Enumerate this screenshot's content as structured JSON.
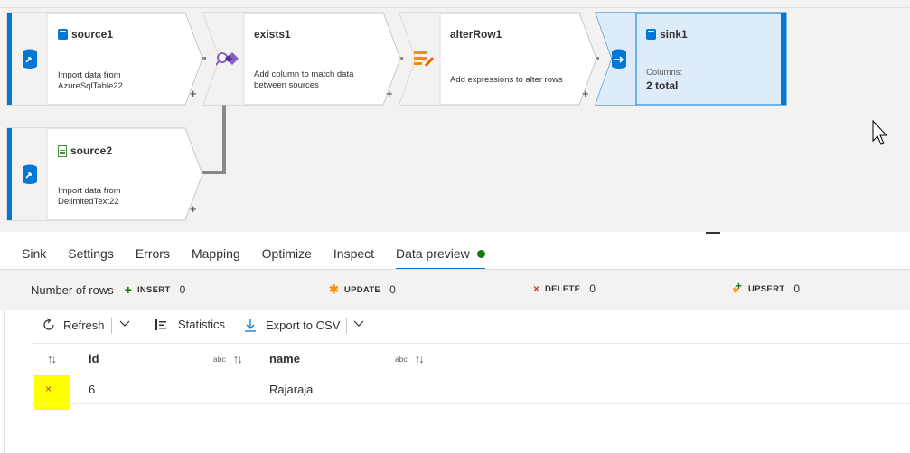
{
  "canvas": {
    "nodes": [
      {
        "id": "source1",
        "title": "source1",
        "desc_line1": "Import data from",
        "desc_line2": "AzureSqlTable22",
        "icon": "sql-table-icon",
        "add": "+"
      },
      {
        "id": "exists1",
        "title": "exists1",
        "desc_line1": "Add column to match data",
        "desc_line2": "between sources",
        "icon": "exists-icon",
        "add": "+"
      },
      {
        "id": "alterRow1",
        "title": "alterRow1",
        "desc_line1": "Add expressions to alter rows",
        "desc_line2": "",
        "icon": "alter-row-icon",
        "add": "+"
      },
      {
        "id": "sink1",
        "title": "sink1",
        "desc_line1": "Columns:",
        "desc_line2": "2 total",
        "icon": "sql-table-icon",
        "selected": true
      },
      {
        "id": "source2",
        "title": "source2",
        "desc_line1": "Import data from",
        "desc_line2": "DelimitedText22",
        "icon": "delimited-text-icon",
        "add": "+"
      }
    ]
  },
  "tabs": [
    {
      "label": "Sink"
    },
    {
      "label": "Settings"
    },
    {
      "label": "Errors"
    },
    {
      "label": "Mapping"
    },
    {
      "label": "Optimize"
    },
    {
      "label": "Inspect"
    },
    {
      "label": "Data preview",
      "active": true,
      "status": "green-dot"
    }
  ],
  "counts": {
    "label": "Number of rows",
    "insert": {
      "label": "INSERT",
      "value": "0",
      "color": "#107c10"
    },
    "update": {
      "label": "UPDATE",
      "value": "0",
      "color": "#ff8c00"
    },
    "delete": {
      "label": "DELETE",
      "value": "0",
      "color": "#d13438"
    },
    "upsert": {
      "label": "UPSERT",
      "value": "0",
      "color": "#107c10"
    }
  },
  "toolbar": {
    "refresh": "Refresh",
    "statistics": "Statistics",
    "export": "Export to CSV"
  },
  "grid": {
    "columns": [
      {
        "name": "id",
        "type": ""
      },
      {
        "name": "name",
        "type": "abc"
      }
    ],
    "id_type": "abc",
    "name_type": "abc",
    "rows": [
      {
        "action": "delete",
        "action_glyph": "×",
        "id": "6",
        "name": "Rajaraja"
      }
    ]
  },
  "colors": {
    "accent": "#0078d4",
    "selected_node_bg": "#deecf9",
    "highlight": "#ffff00"
  }
}
